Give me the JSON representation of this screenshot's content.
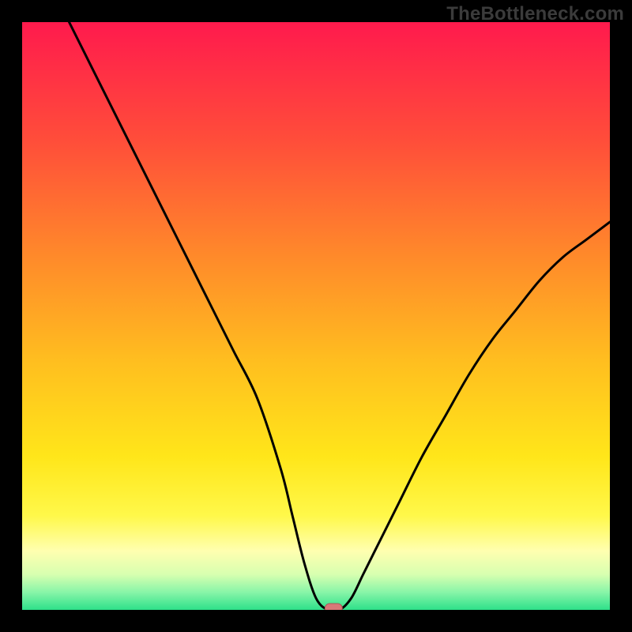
{
  "watermark": "TheBottleneck.com",
  "chart_data": {
    "type": "line",
    "title": "",
    "xlabel": "",
    "ylabel": "",
    "xlim": [
      0,
      100
    ],
    "ylim": [
      0,
      100
    ],
    "grid": false,
    "legend": false,
    "series": [
      {
        "name": "bottleneck-curve",
        "x": [
          8,
          12,
          16,
          20,
          24,
          28,
          32,
          36,
          40,
          44,
          46,
          48,
          50,
          52,
          54,
          56,
          58,
          60,
          64,
          68,
          72,
          76,
          80,
          84,
          88,
          92,
          96,
          100
        ],
        "y": [
          100,
          92,
          84,
          76,
          68,
          60,
          52,
          44,
          36,
          24,
          16,
          8,
          2,
          0,
          0,
          2,
          6,
          10,
          18,
          26,
          33,
          40,
          46,
          51,
          56,
          60,
          63,
          66
        ]
      }
    ],
    "marker": {
      "x": 53,
      "y": 0,
      "shape": "pill",
      "color": "#d87878"
    },
    "background_gradient": {
      "stops": [
        {
          "pos": 0.0,
          "color": "#ff1a4d"
        },
        {
          "pos": 0.2,
          "color": "#ff4d3a"
        },
        {
          "pos": 0.4,
          "color": "#ff8a2a"
        },
        {
          "pos": 0.58,
          "color": "#ffbf1f"
        },
        {
          "pos": 0.74,
          "color": "#ffe61a"
        },
        {
          "pos": 0.84,
          "color": "#fff84a"
        },
        {
          "pos": 0.9,
          "color": "#ffffb0"
        },
        {
          "pos": 0.94,
          "color": "#d7ffb0"
        },
        {
          "pos": 0.97,
          "color": "#88f5a8"
        },
        {
          "pos": 1.0,
          "color": "#2ee08a"
        }
      ]
    }
  }
}
